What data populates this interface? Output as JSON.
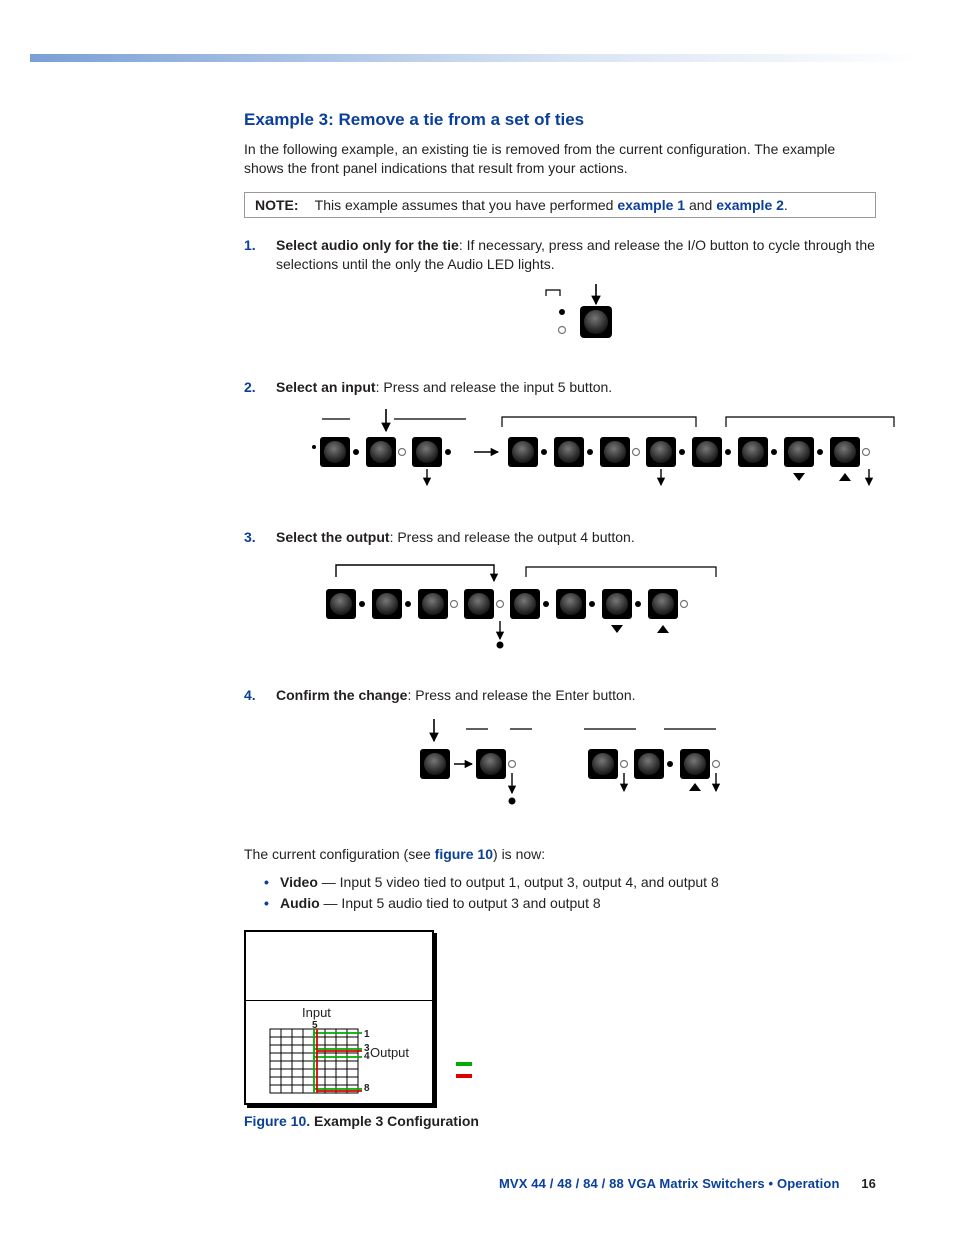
{
  "heading": "Example 3: Remove a tie from a set of ties",
  "intro": "In the following example, an existing tie is removed from the current configuration. The example shows the front panel indications that result from your actions.",
  "note": {
    "label": "NOTE:",
    "before": "This example assumes that you have performed ",
    "link1": "example 1",
    "mid": " and ",
    "link2": "example 2",
    "after": "."
  },
  "steps": [
    {
      "num": "1.",
      "title": "Select audio only for the tie",
      "body": ": If necessary, press and release the I/O button to cycle through the selections until the only the Audio LED lights."
    },
    {
      "num": "2.",
      "title": "Select an input",
      "body": ": Press and release the input 5 button."
    },
    {
      "num": "3.",
      "title": "Select the output",
      "body": ": Press and release the output 4 button."
    },
    {
      "num": "4.",
      "title": "Confirm the change",
      "body": ": Press and release the Enter button."
    }
  ],
  "config_line": {
    "before": "The current configuration (see ",
    "link": "figure 10",
    "after": ") is now:"
  },
  "bullets": [
    {
      "label": "Video",
      "text": " — Input 5 video tied to output 1, output 3, output 4, and output 8"
    },
    {
      "label": "Audio",
      "text": " — Input 5 audio tied to output 3 and output 8"
    }
  ],
  "fig": {
    "input": "Input",
    "output": "Output",
    "n5": "5",
    "n1": "1",
    "n3": "3",
    "n4": "4",
    "n8": "8",
    "caption_label": "Figure 10. ",
    "caption_text": "Example 3 Configuration"
  },
  "footer": {
    "text": "MVX 44 / 48 / 84 / 88 VGA Matrix Switchers • Operation",
    "page": "16"
  }
}
